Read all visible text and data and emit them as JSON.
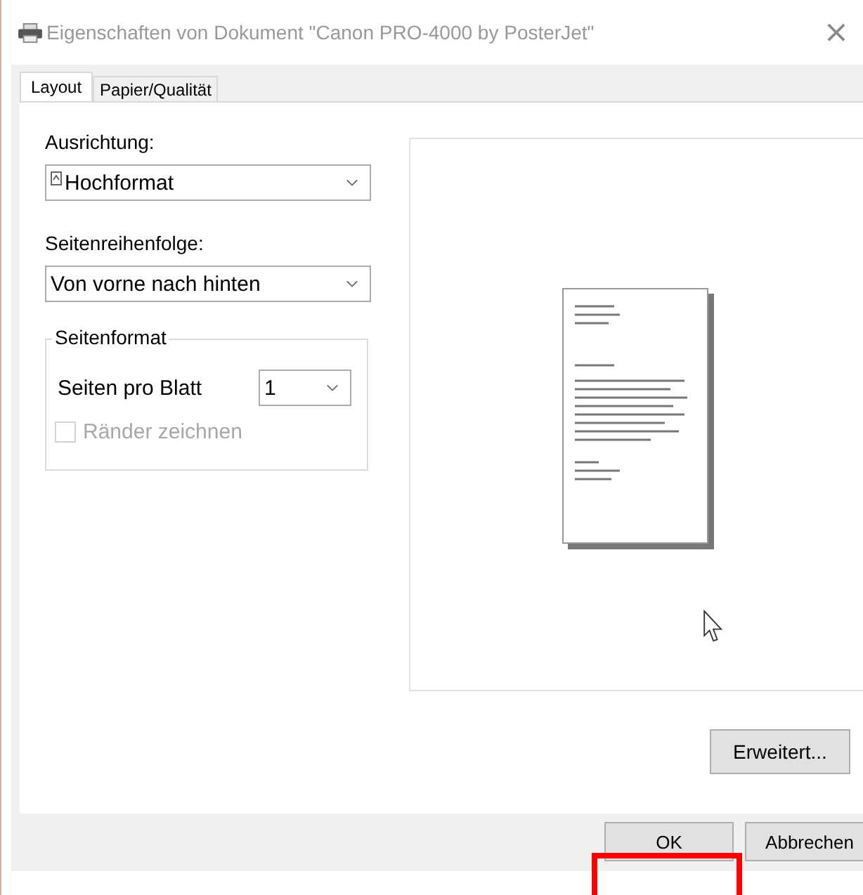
{
  "window": {
    "title": "Eigenschaften von Dokument \"Canon PRO-4000 by PosterJet\"",
    "active": false,
    "close": "×"
  },
  "tabs": [
    {
      "label": "Layout",
      "selected": true
    },
    {
      "label": "Papier/Qualität",
      "selected": false
    }
  ],
  "orientation": {
    "label": "Ausrichtung:",
    "value": "Hochformat"
  },
  "page_order": {
    "label": "Seitenreihenfolge:",
    "value": "Von vorne nach hinten"
  },
  "page_format": {
    "title": "Seitenformat",
    "pages_per_sheet": {
      "label": "Seiten pro Blatt",
      "value": "1"
    },
    "draw_borders": {
      "label": "Ränder zeichnen",
      "checked": false,
      "disabled": true
    }
  },
  "advanced_button": "Erweitert...",
  "buttons": [
    {
      "label": "OK",
      "highlighted": true
    },
    {
      "label": "Abbrechen",
      "highlighted": false
    }
  ]
}
